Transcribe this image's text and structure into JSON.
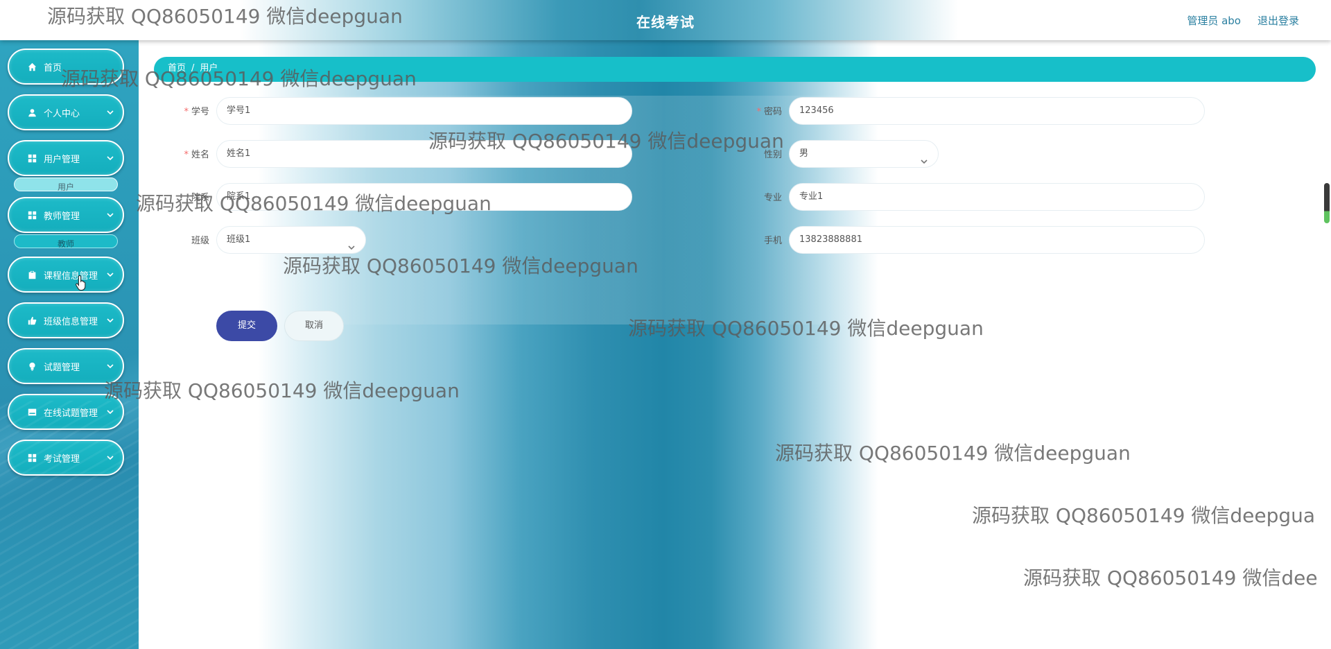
{
  "app": {
    "title": "在线考试"
  },
  "header": {
    "admin_label": "管理员 abo",
    "logout": "退出登录"
  },
  "sidebar": {
    "items": [
      {
        "label": "首页",
        "icon": "home-icon"
      },
      {
        "label": "个人中心",
        "icon": "user-icon"
      },
      {
        "label": "用户管理",
        "icon": "grid-icon"
      },
      {
        "label": "教师管理",
        "icon": "grid-icon"
      },
      {
        "label": "课程信息管理",
        "icon": "clipboard-icon"
      },
      {
        "label": "班级信息管理",
        "icon": "thumb-icon"
      },
      {
        "label": "试题管理",
        "icon": "bulb-icon"
      },
      {
        "label": "在线试题管理",
        "icon": "card-icon"
      },
      {
        "label": "考试管理",
        "icon": "grid-icon"
      }
    ],
    "submenus": {
      "user": "用户",
      "teacher": "教师"
    }
  },
  "breadcrumb": {
    "home": "首页",
    "sep": "/",
    "current": "用户"
  },
  "form": {
    "student_no": {
      "label": "学号",
      "value": "学号1"
    },
    "password": {
      "label": "密码",
      "value": "123456"
    },
    "name": {
      "label": "姓名",
      "value": "姓名1"
    },
    "gender": {
      "label": "性别",
      "value": "男"
    },
    "department": {
      "label": "院系",
      "value": "院系1"
    },
    "major": {
      "label": "专业",
      "value": "专业1"
    },
    "class": {
      "label": "班级",
      "value": "班级1"
    },
    "phone": {
      "label": "手机",
      "value": "13823888881"
    },
    "submit": "提交",
    "cancel": "取消"
  },
  "watermark": {
    "text": "源码获取 QQ86050149 微信deepguan",
    "partial_1": "源码获取 QQ86050149 微信deepgua",
    "partial_2": "源码获取 QQ86050149 微信dee"
  }
}
